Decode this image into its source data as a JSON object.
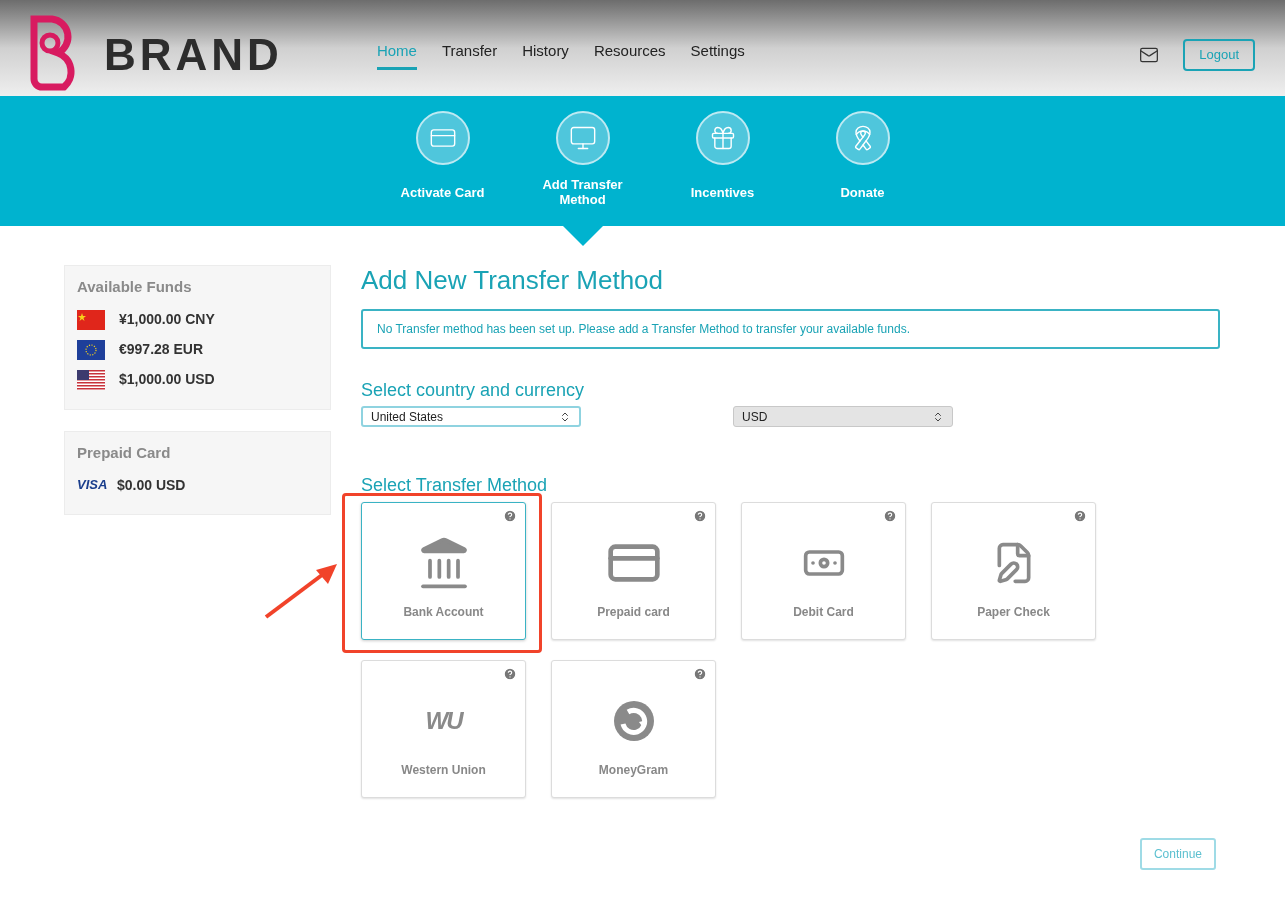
{
  "header": {
    "logo_text": "BRAND",
    "nav": [
      {
        "label": "Home",
        "selected": true
      },
      {
        "label": "Transfer",
        "selected": false
      },
      {
        "label": "History",
        "selected": false
      },
      {
        "label": "Resources",
        "selected": false
      },
      {
        "label": "Settings",
        "selected": false
      }
    ],
    "logout": "Logout"
  },
  "actions": [
    {
      "label": "Activate Card",
      "kind": "card",
      "selected": false
    },
    {
      "label": "Add Transfer Method",
      "kind": "monitor",
      "selected": true
    },
    {
      "label": "Incentives",
      "kind": "gift",
      "selected": false
    },
    {
      "label": "Donate",
      "kind": "ribbon",
      "selected": false
    }
  ],
  "sidebar": {
    "funds_title": "Available Funds",
    "funds": [
      {
        "kind": "cn",
        "amount": "¥1,000.00 CNY"
      },
      {
        "kind": "eu",
        "amount": "€997.28 EUR"
      },
      {
        "kind": "us",
        "amount": "$1,000.00 USD"
      }
    ],
    "prepaid_title": "Prepaid Card",
    "prepaid": {
      "brand": "VISA",
      "amount": "$0.00 USD"
    }
  },
  "main": {
    "title": "Add New Transfer Method",
    "notice": "No Transfer method has been set up. Please add a Transfer Method to transfer your available funds.",
    "country_heading": "Select country and currency",
    "selects": [
      {
        "value": "United States",
        "focused": true
      },
      {
        "value": "USD",
        "focused": false
      }
    ],
    "method_heading": "Select Transfer Method",
    "methods": [
      {
        "label": "Bank Account",
        "kind": "bank",
        "selected": true
      },
      {
        "label": "Prepaid card",
        "kind": "prepaid",
        "selected": false
      },
      {
        "label": "Debit Card",
        "kind": "debit",
        "selected": false
      },
      {
        "label": "Paper Check",
        "kind": "check",
        "selected": false
      },
      {
        "label": "Western Union",
        "kind": "wu",
        "logo_text": "WU",
        "selected": false
      },
      {
        "label": "MoneyGram",
        "kind": "moneygram",
        "selected": false
      }
    ],
    "continue": "Continue"
  }
}
